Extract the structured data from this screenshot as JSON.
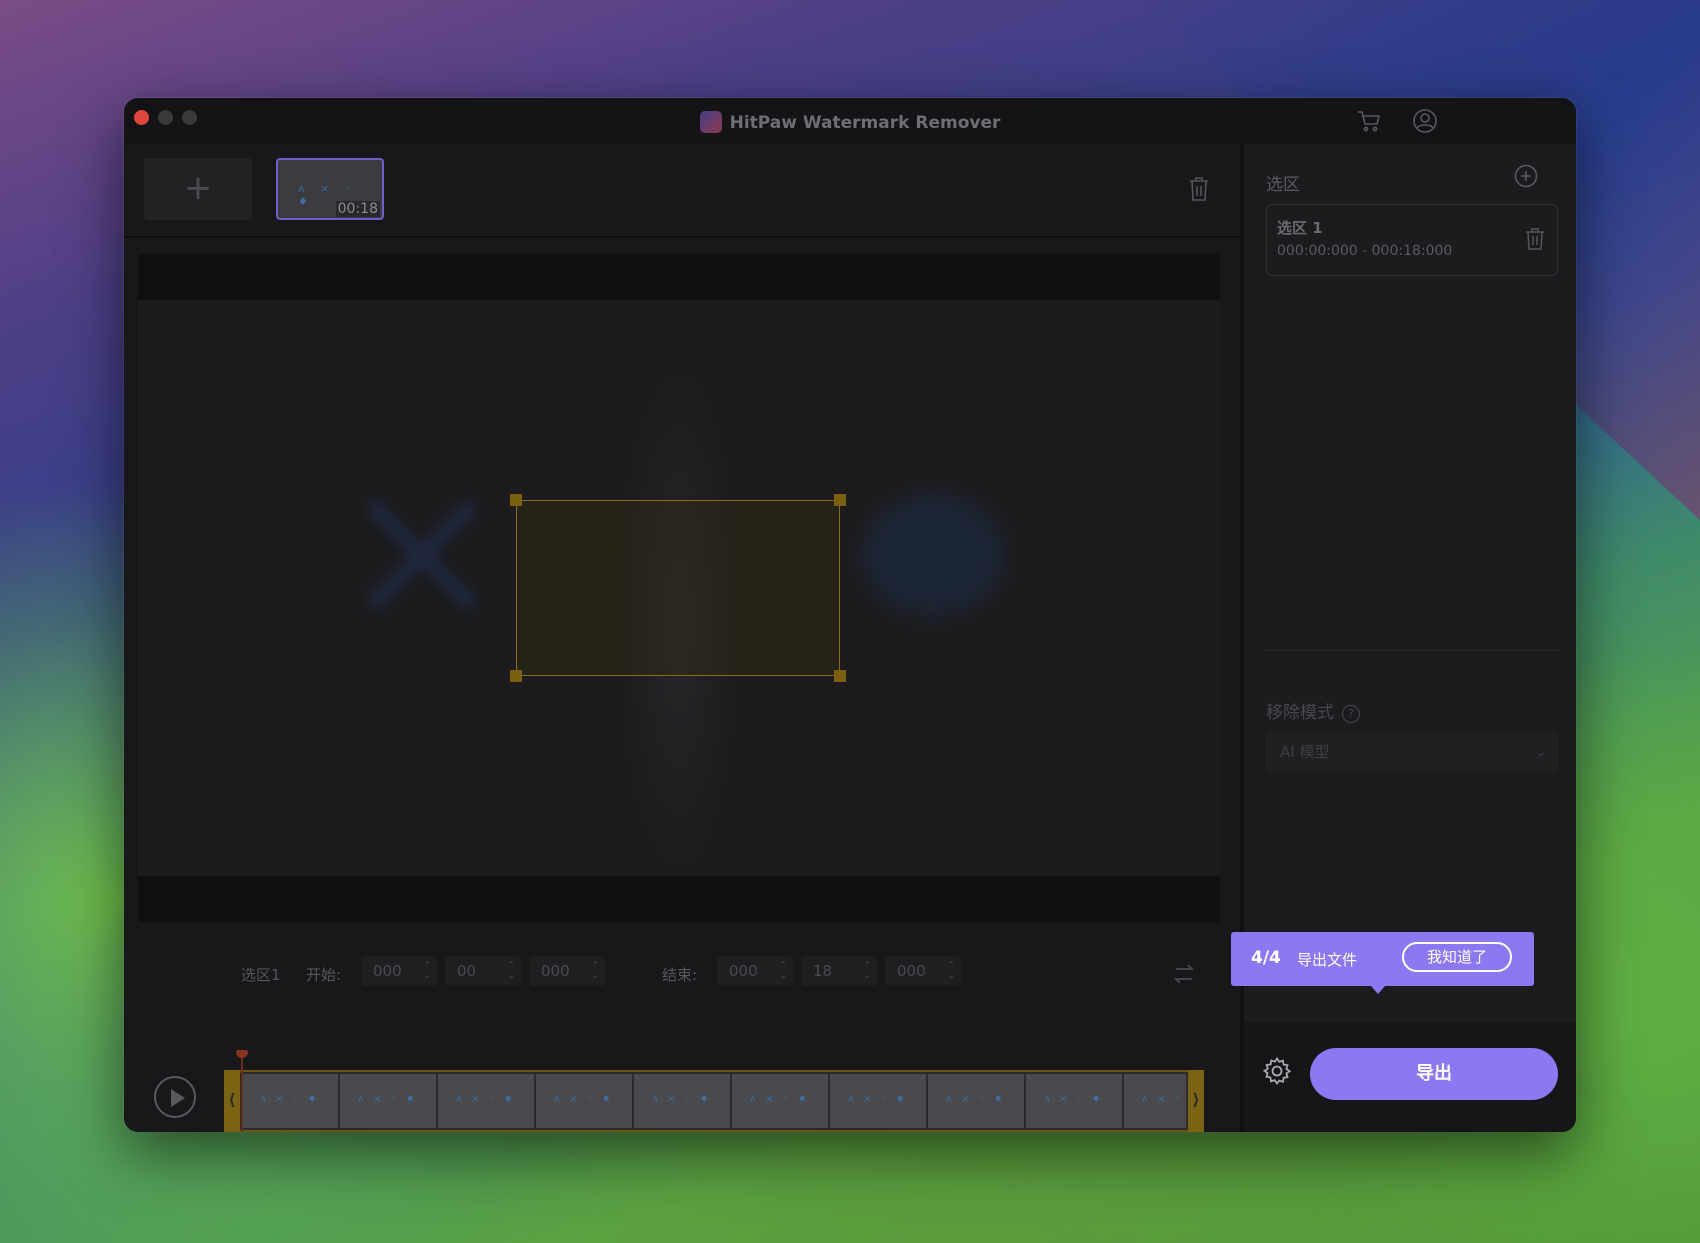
{
  "window": {
    "title": "HitPaw Watermark Remover"
  },
  "icons": {
    "cart": "cart-icon",
    "account": "user-icon",
    "add": "plus-icon",
    "trash": "trash-icon",
    "settings": "gear-icon",
    "play": "play-icon"
  },
  "media": {
    "add_label": "+",
    "thumb_duration": "00:18",
    "thumb_marks": "ʌ × ◦ ♦"
  },
  "selection_panel": {
    "title": "选区",
    "items": [
      {
        "name": "选区 1",
        "time_range": "000:00:000 - 000:18:000"
      }
    ]
  },
  "remove_mode": {
    "title": "移除模式",
    "help": "?",
    "value": "AI 模型",
    "chevron": "⌄"
  },
  "range_bar": {
    "selection_label": "选区1",
    "start_label": "开始:",
    "start": [
      "000",
      "00",
      "000"
    ],
    "end_label": "结束:",
    "end": [
      "000",
      "18",
      "000"
    ],
    "spin": "⌃\n⌄"
  },
  "timeline": {
    "left_handle": "⟨",
    "right_handle": "⟩",
    "frame_count": 10
  },
  "export": {
    "label": "导出"
  },
  "tooltip": {
    "step": "4/4",
    "text": "导出文件",
    "dismiss_label": "我知道了"
  },
  "colors": {
    "accent": "#8b78f2",
    "selection": "#8a6a12",
    "close": "#e0443e"
  }
}
